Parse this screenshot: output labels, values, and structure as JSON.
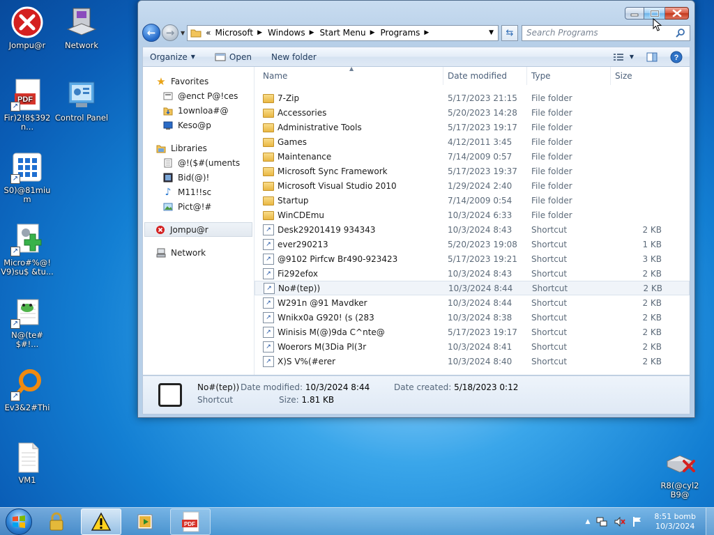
{
  "desktop": {
    "icons": [
      {
        "label": "Jompu@r"
      },
      {
        "label": "Network"
      },
      {
        "label": "Fir)2!8$392n..."
      },
      {
        "label": "Control Panel"
      },
      {
        "label": "S0)@81mium"
      },
      {
        "label": "Micro#%@!\nV9)su$ &tu..."
      },
      {
        "label": "N@(te#$#!..."
      },
      {
        "label": "Ev3&2#Thi"
      },
      {
        "label": "VM1"
      },
      {
        "label": "R8(@cyl2\nB9@"
      }
    ]
  },
  "window": {
    "address": {
      "overflow": "«",
      "crumbs": [
        "Microsoft",
        "Windows",
        "Start Menu",
        "Programs"
      ]
    },
    "search_placeholder": "Search Programs",
    "toolbar": {
      "organize": "Organize",
      "open": "Open",
      "new_folder": "New folder"
    },
    "nav": {
      "favorites": "Favorites",
      "fav_items": [
        "@enct P@!ces",
        "1ownloa#@",
        "Keso@p"
      ],
      "libraries": "Libraries",
      "lib_items": [
        "@!($#(uments",
        "Bid(@)!",
        "M11!!sc",
        "Pict@!#"
      ],
      "computer": "Jompu@r",
      "network": "Network"
    },
    "columns": {
      "name": "Name",
      "date": "Date modified",
      "type": "Type",
      "size": "Size"
    },
    "files": [
      {
        "name": "7-Zip",
        "date": "5/17/2023 21:15",
        "type": "File folder",
        "size": "",
        "kind": "folder"
      },
      {
        "name": "Accessories",
        "date": "5/20/2023 14:28",
        "type": "File folder",
        "size": "",
        "kind": "folder"
      },
      {
        "name": "Administrative Tools",
        "date": "5/17/2023 19:17",
        "type": "File folder",
        "size": "",
        "kind": "folder"
      },
      {
        "name": "Games",
        "date": "4/12/2011 3:45",
        "type": "File folder",
        "size": "",
        "kind": "folder"
      },
      {
        "name": "Maintenance",
        "date": "7/14/2009 0:57",
        "type": "File folder",
        "size": "",
        "kind": "folder"
      },
      {
        "name": "Microsoft Sync Framework",
        "date": "5/17/2023 19:37",
        "type": "File folder",
        "size": "",
        "kind": "folder"
      },
      {
        "name": "Microsoft Visual Studio 2010",
        "date": "1/29/2024 2:40",
        "type": "File folder",
        "size": "",
        "kind": "folder"
      },
      {
        "name": "Startup",
        "date": "7/14/2009 0:54",
        "type": "File folder",
        "size": "",
        "kind": "folder"
      },
      {
        "name": "WinCDEmu",
        "date": "10/3/2024 6:33",
        "type": "File folder",
        "size": "",
        "kind": "folder"
      },
      {
        "name": "Desk29201419 934343",
        "date": "10/3/2024 8:43",
        "type": "Shortcut",
        "size": "2 KB",
        "kind": "shortcut"
      },
      {
        "name": "ever290213",
        "date": "5/20/2023 19:08",
        "type": "Shortcut",
        "size": "1 KB",
        "kind": "shortcut"
      },
      {
        "name": "@9102 Pirfcw Br490-923423",
        "date": "5/17/2023 19:21",
        "type": "Shortcut",
        "size": "3 KB",
        "kind": "shortcut"
      },
      {
        "name": "Fi292efox",
        "date": "10/3/2024 8:43",
        "type": "Shortcut",
        "size": "2 KB",
        "kind": "shortcut"
      },
      {
        "name": "No#(tep))",
        "date": "10/3/2024 8:44",
        "type": "Shortcut",
        "size": "2 KB",
        "kind": "shortcut"
      },
      {
        "name": "W291n @91 Mavdker",
        "date": "10/3/2024 8:44",
        "type": "Shortcut",
        "size": "2 KB",
        "kind": "shortcut"
      },
      {
        "name": "Wnikx0a G920! (s (283",
        "date": "10/3/2024 8:38",
        "type": "Shortcut",
        "size": "2 KB",
        "kind": "shortcut"
      },
      {
        "name": "Winisis M(@)9da C^nte@",
        "date": "5/17/2023 19:17",
        "type": "Shortcut",
        "size": "2 KB",
        "kind": "shortcut"
      },
      {
        "name": "Woerors M(3Dia Pl(3r",
        "date": "10/3/2024 8:41",
        "type": "Shortcut",
        "size": "2 KB",
        "kind": "shortcut"
      },
      {
        "name": "X)S V%(#erer",
        "date": "10/3/2024 8:40",
        "type": "Shortcut",
        "size": "2 KB",
        "kind": "shortcut"
      }
    ],
    "details": {
      "name": "No#(tep))",
      "type": "Shortcut",
      "modified_label": "Date modified:",
      "modified": "10/3/2024 8:44",
      "size_label": "Size:",
      "size": "1.81 KB",
      "created_label": "Date created:",
      "created": "5/18/2023 0:12"
    }
  },
  "taskbar": {
    "clock_time": "8:51 bomb",
    "clock_date": "10/3/2024"
  },
  "colors": {
    "accent": "#2268c7",
    "close": "#c2381b"
  }
}
